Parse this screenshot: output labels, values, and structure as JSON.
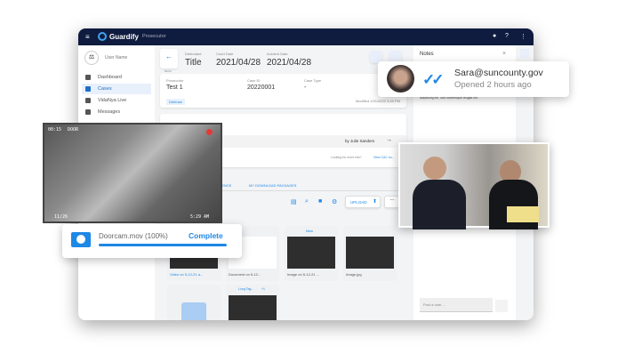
{
  "app": {
    "brand": "Guardify",
    "module": "Prosecutor"
  },
  "sidebar": {
    "user": "User Name",
    "items": [
      {
        "label": "Dashboard"
      },
      {
        "label": "Cases"
      },
      {
        "label": "VidaNya Live"
      },
      {
        "label": "Messages"
      }
    ],
    "active": "Cases"
  },
  "case": {
    "back": "BACK",
    "defendant_label": "Defendant",
    "defendant": "Title",
    "court_date_label": "Court Date",
    "court_date": "2021/04/28",
    "incident_date_label": "Incident Date",
    "incident_date": "2021/04/28",
    "prosecutor_label": "Prosecutor",
    "prosecutor": "Test 1",
    "case_id_label": "Case ID",
    "case_id": "20220001",
    "case_type_label": "Case Type",
    "case_type": "-",
    "defense": "Defense",
    "modified": "Modified 1/21/2022 3:45 PM"
  },
  "activity": {
    "title": "...ion",
    "author": "by Julie Sanders",
    "more_info": "Looking for more info?",
    "view_link": "View CAC co..."
  },
  "tabs": [
    "...ENCE",
    "MY DOWNLOAD PACKAGES"
  ],
  "toolbar": {
    "upload": "UPLOAD",
    "more": "..."
  },
  "files": [
    {
      "name": "Video on 5-12-21 a...",
      "badge": ""
    },
    {
      "name": "Document on 5-12...",
      "badge": ""
    },
    {
      "name": "Image on 5-12-21 ...",
      "badge": "New"
    },
    {
      "name": "Image.jpg",
      "badge": ""
    },
    {
      "name": "",
      "badge": ""
    },
    {
      "name": "",
      "badge": "Long Tag...",
      "extra": "+1"
    }
  ],
  "notes": {
    "title": "Notes",
    "text": "adipiscing elit. Sed scelerisque feugiat elit.",
    "placeholder": "Post a note ..."
  },
  "email_card": {
    "email": "Sara@suncounty.gov",
    "status": "Opened 2 hours ago",
    "accent": "#1e88e5"
  },
  "video": {
    "time": "00:15",
    "label": "DOOR",
    "date": "11/26",
    "clock": "5:29 AM",
    "rec_color": "#e53935"
  },
  "upload": {
    "file": "Doorcam.mov (100%)",
    "status": "Complete",
    "progress": 1.0,
    "accent": "#1e88e5"
  }
}
